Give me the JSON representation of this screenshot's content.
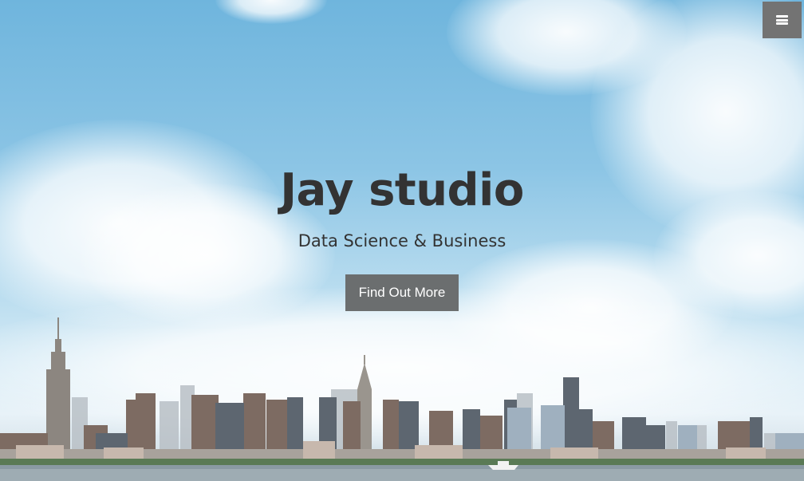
{
  "nav": {
    "menu_icon": "hamburger-icon"
  },
  "hero": {
    "title": "Jay studio",
    "subtitle": "Data Science & Business",
    "cta_label": "Find Out More"
  },
  "colors": {
    "title_text": "#333333",
    "cta_background": "#6b6e6f",
    "menu_background": "#737373"
  }
}
